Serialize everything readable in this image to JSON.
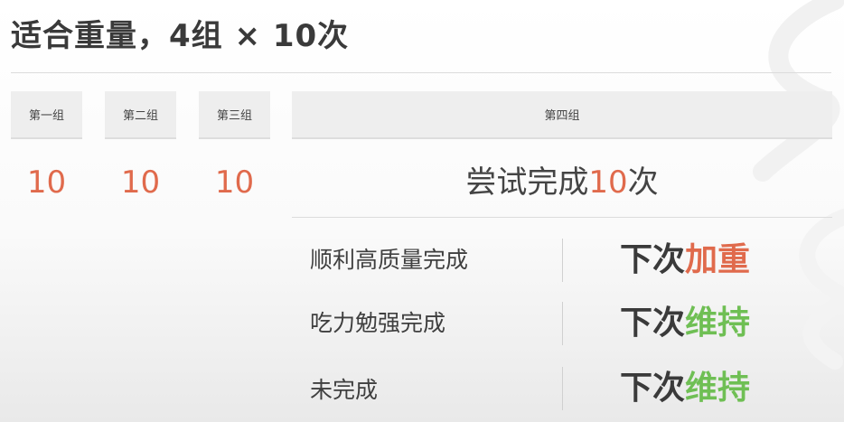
{
  "title": "适合重量，4组 × 10次",
  "sets": [
    {
      "label": "第一组",
      "value": "10"
    },
    {
      "label": "第二组",
      "value": "10"
    },
    {
      "label": "第三组",
      "value": "10"
    },
    {
      "label": "第四组"
    }
  ],
  "fourth": {
    "attempt_prefix": "尝试完成",
    "attempt_number": "10",
    "attempt_suffix": "次"
  },
  "outcomes": [
    {
      "condition": "顺利高质量完成",
      "result_prefix": "下次",
      "result_action": "加重",
      "action_color": "#e06a4c"
    },
    {
      "condition": "吃力勉强完成",
      "result_prefix": "下次",
      "result_action": "维持",
      "action_color": "#6fbf54"
    },
    {
      "condition": "未完成",
      "result_prefix": "下次",
      "result_action": "维持",
      "action_color": "#6fbf54"
    }
  ]
}
